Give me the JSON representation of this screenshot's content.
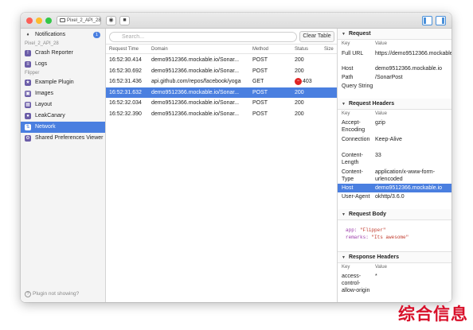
{
  "toolbar": {
    "device": "Pixel_2_API_28",
    "camera_icon": "camera-icon",
    "video_icon": "video-icon"
  },
  "sidebar": {
    "notifications": {
      "label": "Notifications",
      "count": "1"
    },
    "device_section": "Pixel_2_API_28",
    "device_items": [
      {
        "label": "Crash Reporter"
      },
      {
        "label": "Logs"
      }
    ],
    "flipper_section": "Flipper",
    "flipper_items": [
      {
        "label": "Example Plugin"
      },
      {
        "label": "Images"
      },
      {
        "label": "Layout"
      },
      {
        "label": "LeakCanary"
      },
      {
        "label": "Network",
        "active": true
      },
      {
        "label": "Shared Preferences Viewer"
      }
    ],
    "footer": "Plugin not showing?"
  },
  "network": {
    "search_placeholder": "Search...",
    "clear_button": "Clear Table",
    "columns": [
      "Request Time",
      "Domain",
      "Method",
      "Status",
      "Size"
    ],
    "rows": [
      {
        "time": "16:52:30.414",
        "domain": "demo9512366.mockable.io/Sonar...",
        "method": "POST",
        "status": "200",
        "error": false
      },
      {
        "time": "16:52:30.692",
        "domain": "demo9512366.mockable.io/Sonar...",
        "method": "POST",
        "status": "200",
        "error": false
      },
      {
        "time": "16:52:31.436",
        "domain": "api.github.com/repos/facebook/yoga",
        "method": "GET",
        "status": "403",
        "error": true
      },
      {
        "time": "16:52:31.632",
        "domain": "demo9512366.mockable.io/Sonar...",
        "method": "POST",
        "status": "200",
        "error": false,
        "selected": true
      },
      {
        "time": "16:52:32.034",
        "domain": "demo9512366.mockable.io/Sonar...",
        "method": "POST",
        "status": "200",
        "error": false
      },
      {
        "time": "16:52:32.390",
        "domain": "demo9512366.mockable.io/Sonar...",
        "method": "POST",
        "status": "200",
        "error": false
      }
    ]
  },
  "detail": {
    "request": {
      "title": "Request",
      "key_header": "Key",
      "value_header": "Value",
      "rows": [
        {
          "k": "Full URL",
          "v": "https://demo9512366.mockable.io/SonarPost"
        },
        {
          "k": "Host",
          "v": "demo9512366.mockable.io"
        },
        {
          "k": "Path",
          "v": "/SonarPost"
        },
        {
          "k": "Query String",
          "v": ""
        }
      ]
    },
    "request_headers": {
      "title": "Request Headers",
      "key_header": "Key",
      "value_header": "Value",
      "rows": [
        {
          "k": "Accept-Encoding",
          "v": "gzip"
        },
        {
          "k": "Connection",
          "v": "Keep-Alive"
        },
        {
          "k": "Content-Length",
          "v": "33"
        },
        {
          "k": "Content-Type",
          "v": "application/x-www-form-urlencoded"
        },
        {
          "k": "Host",
          "v": "demo9512366.mockable.io",
          "selected": true
        },
        {
          "k": "User-Agent",
          "v": "okhttp/3.6.0"
        }
      ]
    },
    "request_body": {
      "title": "Request Body",
      "line1_key": "app:",
      "line1_val": "\"Flipper\"",
      "line2_key": "remarks:",
      "line2_val": "\"Its awesome\""
    },
    "response_headers": {
      "title": "Response Headers",
      "key_header": "Key",
      "value_header": "Value",
      "rows": [
        {
          "k": "access-control-allow-origin",
          "v": "*"
        }
      ]
    }
  },
  "watermark": "综合信息"
}
